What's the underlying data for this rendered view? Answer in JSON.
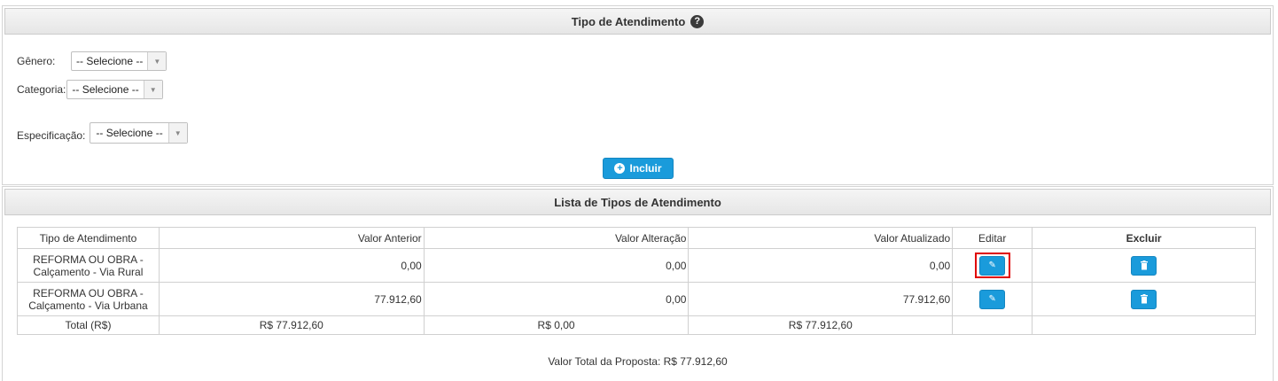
{
  "form_panel": {
    "title": "Tipo de Atendimento",
    "help_icon": "question-circle-icon",
    "genero": {
      "label": "Gênero:",
      "value": "-- Selecione --"
    },
    "categoria": {
      "label": "Categoria:",
      "value": "-- Selecione --"
    },
    "especificacao": {
      "label": "Especificação:",
      "value": "-- Selecione --"
    },
    "incluir_label": "Incluir",
    "incluir_icon": "plus-circle-icon"
  },
  "list_panel": {
    "title": "Lista de Tipos de Atendimento",
    "columns": [
      "Tipo de Atendimento",
      "Valor Anterior",
      "Valor Alteração",
      "Valor Atualizado",
      "Editar",
      "Excluir"
    ],
    "rows": [
      {
        "tipo_line1": "REFORMA OU OBRA -",
        "tipo_line2": "Calçamento - Via Rural",
        "anterior": "0,00",
        "alteracao": "0,00",
        "atualizado": "0,00"
      },
      {
        "tipo_line1": "REFORMA OU OBRA -",
        "tipo_line2": "Calçamento - Via Urbana",
        "anterior": "77.912,60",
        "alteracao": "0,00",
        "atualizado": "77.912,60"
      }
    ],
    "total": {
      "label": "Total (R$)",
      "anterior": "R$ 77.912,60",
      "alteracao": "R$ 0,00",
      "atualizado": "R$ 77.912,60"
    },
    "edit_icon": "pencil-icon",
    "delete_icon": "trash-icon",
    "valor_total_proposta": "Valor Total da Proposta: R$ 77.912,60"
  },
  "colors": {
    "accent": "#1a9bdb",
    "highlight": "#e00000",
    "header_bg": "#eeeeee"
  }
}
